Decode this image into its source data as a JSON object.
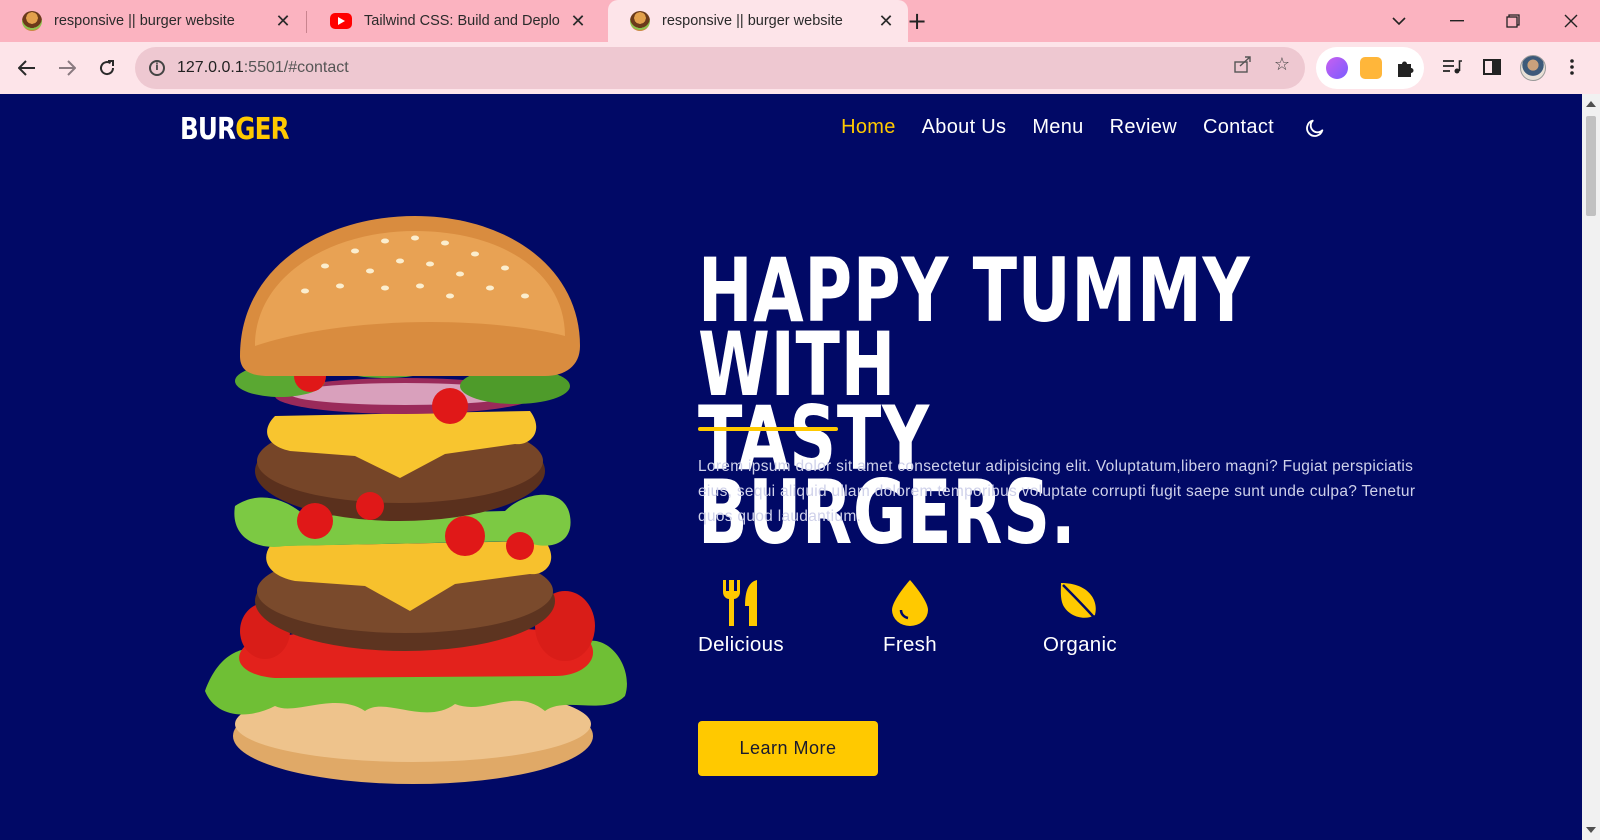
{
  "browser": {
    "tabs": [
      {
        "title": "responsive || burger website",
        "favicon": "burger-favicon",
        "active": false
      },
      {
        "title": "Tailwind CSS: Build and Deploy a",
        "favicon": "youtube-favicon",
        "active": false
      },
      {
        "title": "responsive || burger website",
        "favicon": "burger-favicon",
        "active": true
      }
    ],
    "url_host": "127.0.0.1",
    "url_rest": ":5501/#contact"
  },
  "site": {
    "logo_part1": "BUR",
    "logo_part2": "GER",
    "nav": [
      "Home",
      "About Us",
      "Menu",
      "Review",
      "Contact"
    ],
    "active_nav": "Home",
    "hero": {
      "title_line1": "HAPPY TUMMY WITH",
      "title_line2": "TASTY BURGERS.",
      "description": "Lorem ipsum dolor sit amet consectetur adipisicing elit. Voluptatum,libero magni? Fugiat perspiciatis eius, sequi aliquid ullam dolorem temporibus voluptate corrupti fugit saepe sunt unde culpa? Tenetur quos quod laudantium.",
      "features": [
        {
          "label": "Delicious",
          "icon": "utensils-icon"
        },
        {
          "label": "Fresh",
          "icon": "drop-icon"
        },
        {
          "label": "Organic",
          "icon": "leaf-icon"
        }
      ],
      "cta": "Learn More"
    }
  },
  "colors": {
    "page_bg": "#010966",
    "accent": "#ffc900",
    "tabbar_bg": "#fbb3c0",
    "toolbar_bg": "#fde4e9"
  }
}
